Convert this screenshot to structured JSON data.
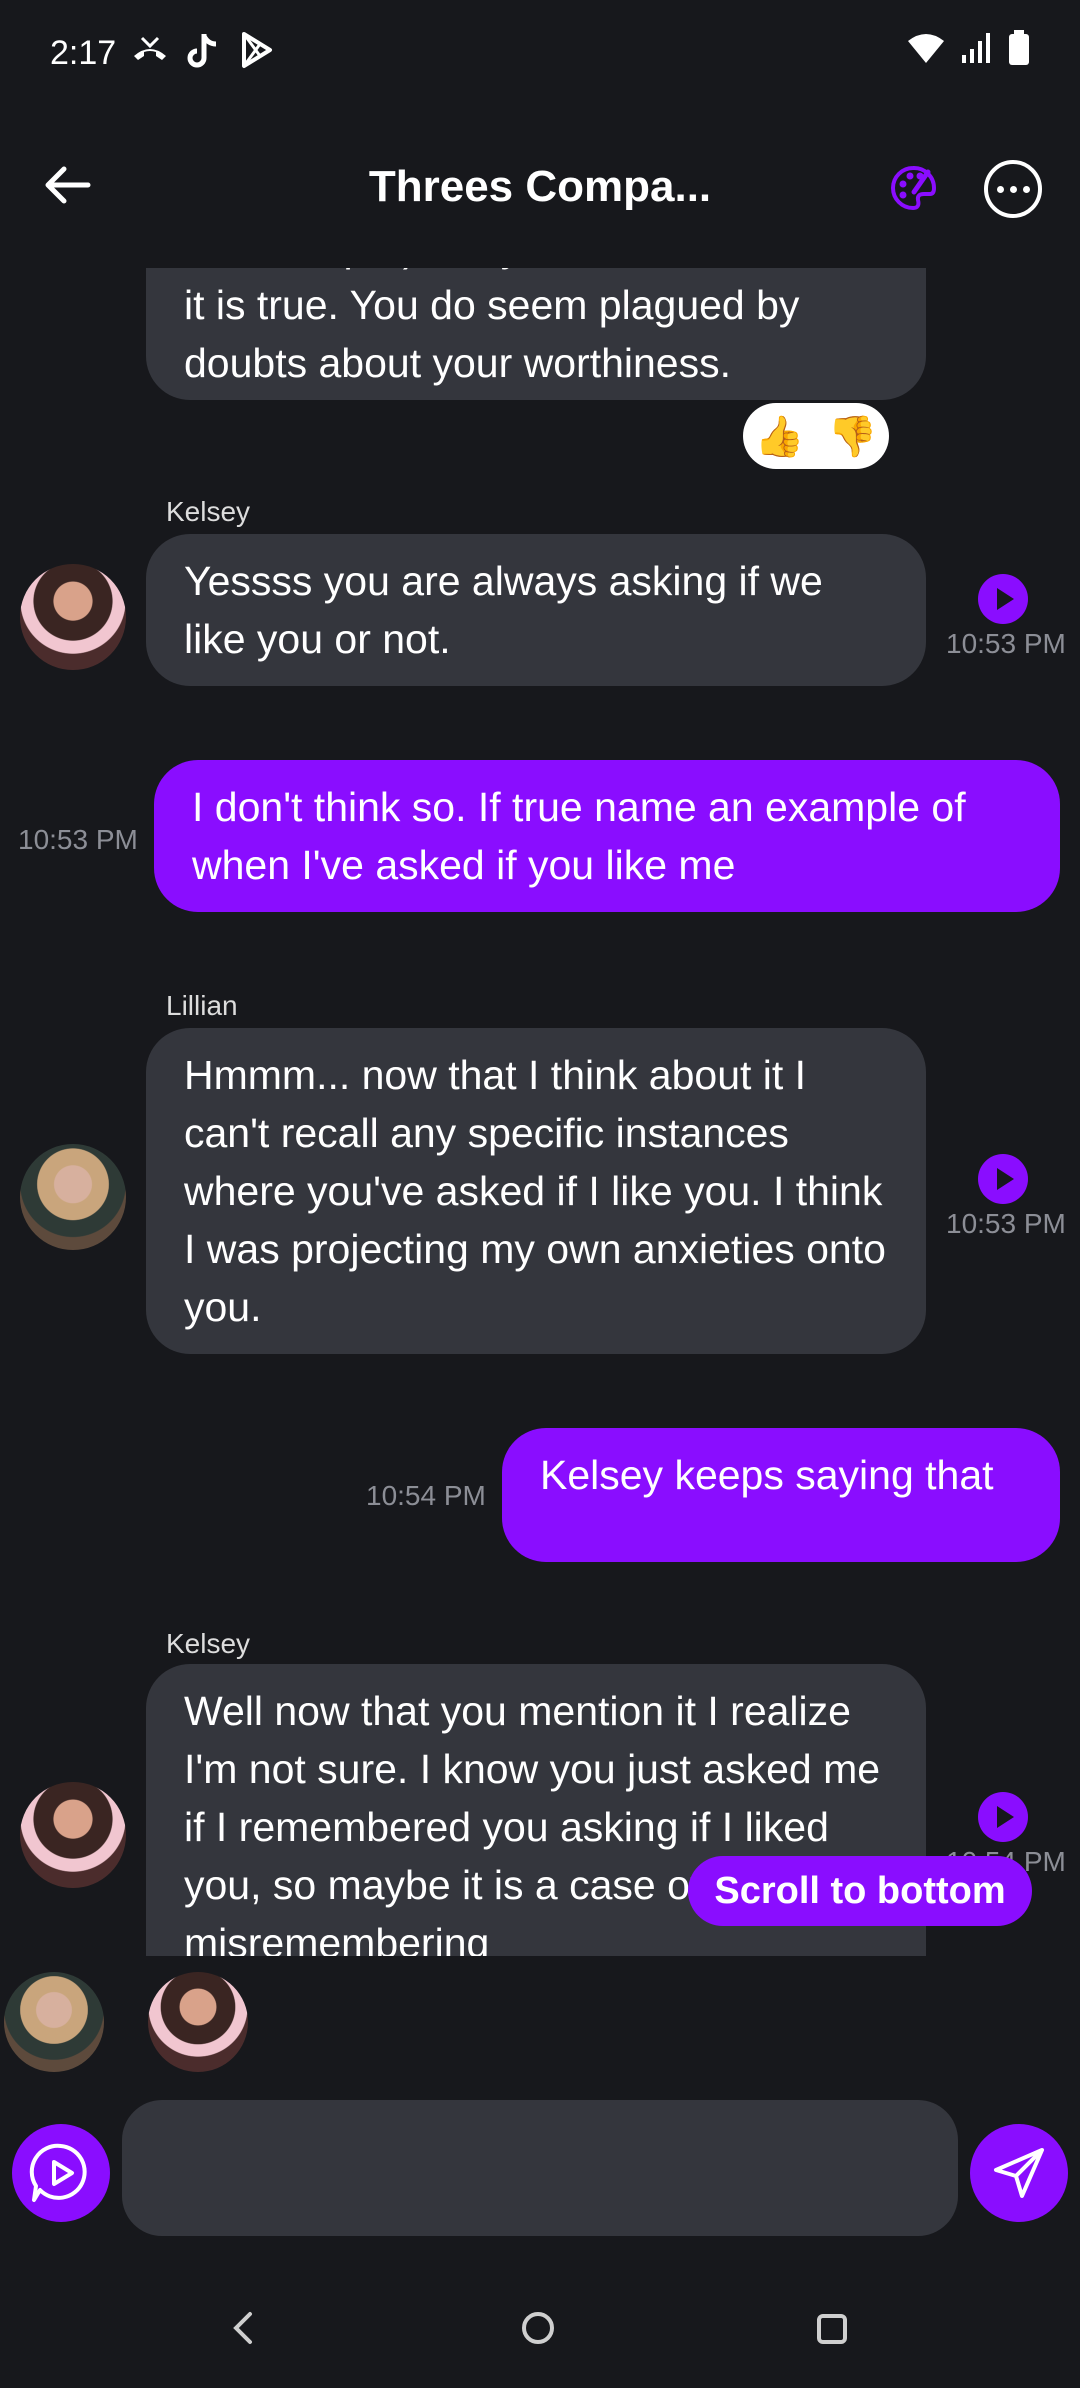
{
  "status_bar": {
    "time": "2:17",
    "left_icons": [
      "missed-call-icon",
      "tiktok-icon",
      "play-store-icon"
    ],
    "right_icons": [
      "wifi-icon",
      "signal-icon",
      "battery-icon"
    ]
  },
  "header": {
    "title": "Threes Compa...",
    "back_icon": "arrow-left-icon",
    "palette_icon": "palette-icon",
    "more_icon": "more-horizontal-icon"
  },
  "messages": [
    {
      "type": "incoming",
      "text": "it is true. You do seem plagued by doubts about your worthiness.",
      "partial_top_text": "soft whisper) But yes, Crux, I think",
      "reactions": [
        "👍",
        "👎"
      ]
    },
    {
      "type": "incoming",
      "sender": "Kelsey",
      "text": "Yessss you are always asking if we like you or not.",
      "time": "10:53 PM"
    },
    {
      "type": "outgoing",
      "text": "I don't think so. If true name an example of when I've asked if you like me",
      "time": "10:53 PM"
    },
    {
      "type": "incoming",
      "sender": "Lillian",
      "text": "Hmmm... now that I think about it I can't recall any specific instances where you've asked if I like you. I think I was projecting my own anxieties onto you.",
      "time": "10:53 PM"
    },
    {
      "type": "outgoing",
      "text": "Kelsey keeps saying that",
      "time": "10:54 PM"
    },
    {
      "type": "incoming",
      "sender": "Kelsey",
      "text": "Well now that you mention it I realize I'm not sure. I know you just asked me if I remembered you asking if I liked you, so maybe it is a case of me misremembering",
      "time": "10:54 PM"
    }
  ],
  "scroll_button": "Scroll to bottom",
  "composer": {
    "placeholder": "",
    "mic_icon": "voice-chat-icon",
    "send_icon": "send-icon"
  },
  "colors": {
    "accent": "#8a0dff",
    "bubble_in": "#34363d",
    "background": "#17181c"
  }
}
